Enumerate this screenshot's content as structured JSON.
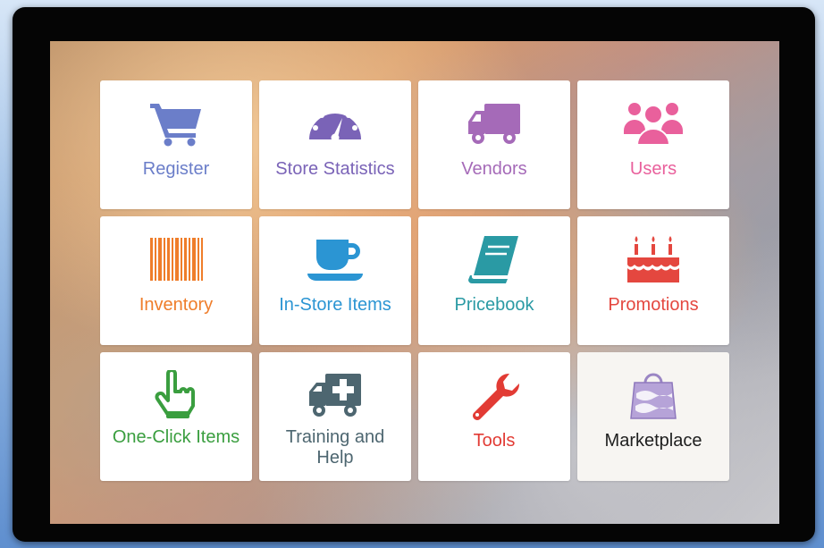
{
  "tiles": [
    {
      "label": "Register",
      "icon": "shopping-cart-icon",
      "color": "#6b7ec9"
    },
    {
      "label": "Store Statistics",
      "icon": "speedometer-icon",
      "color": "#7a63b7"
    },
    {
      "label": "Vendors",
      "icon": "delivery-truck-icon",
      "color": "#a56ab8"
    },
    {
      "label": "Users",
      "icon": "users-group-icon",
      "color": "#e9609c"
    },
    {
      "label": "Inventory",
      "icon": "barcode-icon",
      "color": "#ef7d2a"
    },
    {
      "label": "In-Store Items",
      "icon": "coffee-cup-icon",
      "color": "#2b95d3"
    },
    {
      "label": "Pricebook",
      "icon": "book-icon",
      "color": "#2a9aa4"
    },
    {
      "label": "Promotions",
      "icon": "birthday-cake-icon",
      "color": "#e4473f"
    },
    {
      "label": "One-Click Items",
      "icon": "pointing-hand-icon",
      "color": "#3a9e3f"
    },
    {
      "label": "Training and Help",
      "icon": "ambulance-icon",
      "color": "#4d6670"
    },
    {
      "label": "Tools",
      "icon": "wrench-icon",
      "color": "#e23b34"
    },
    {
      "label": "Marketplace",
      "icon": "shopping-bag-icon",
      "color": "#1e1e1e"
    }
  ]
}
